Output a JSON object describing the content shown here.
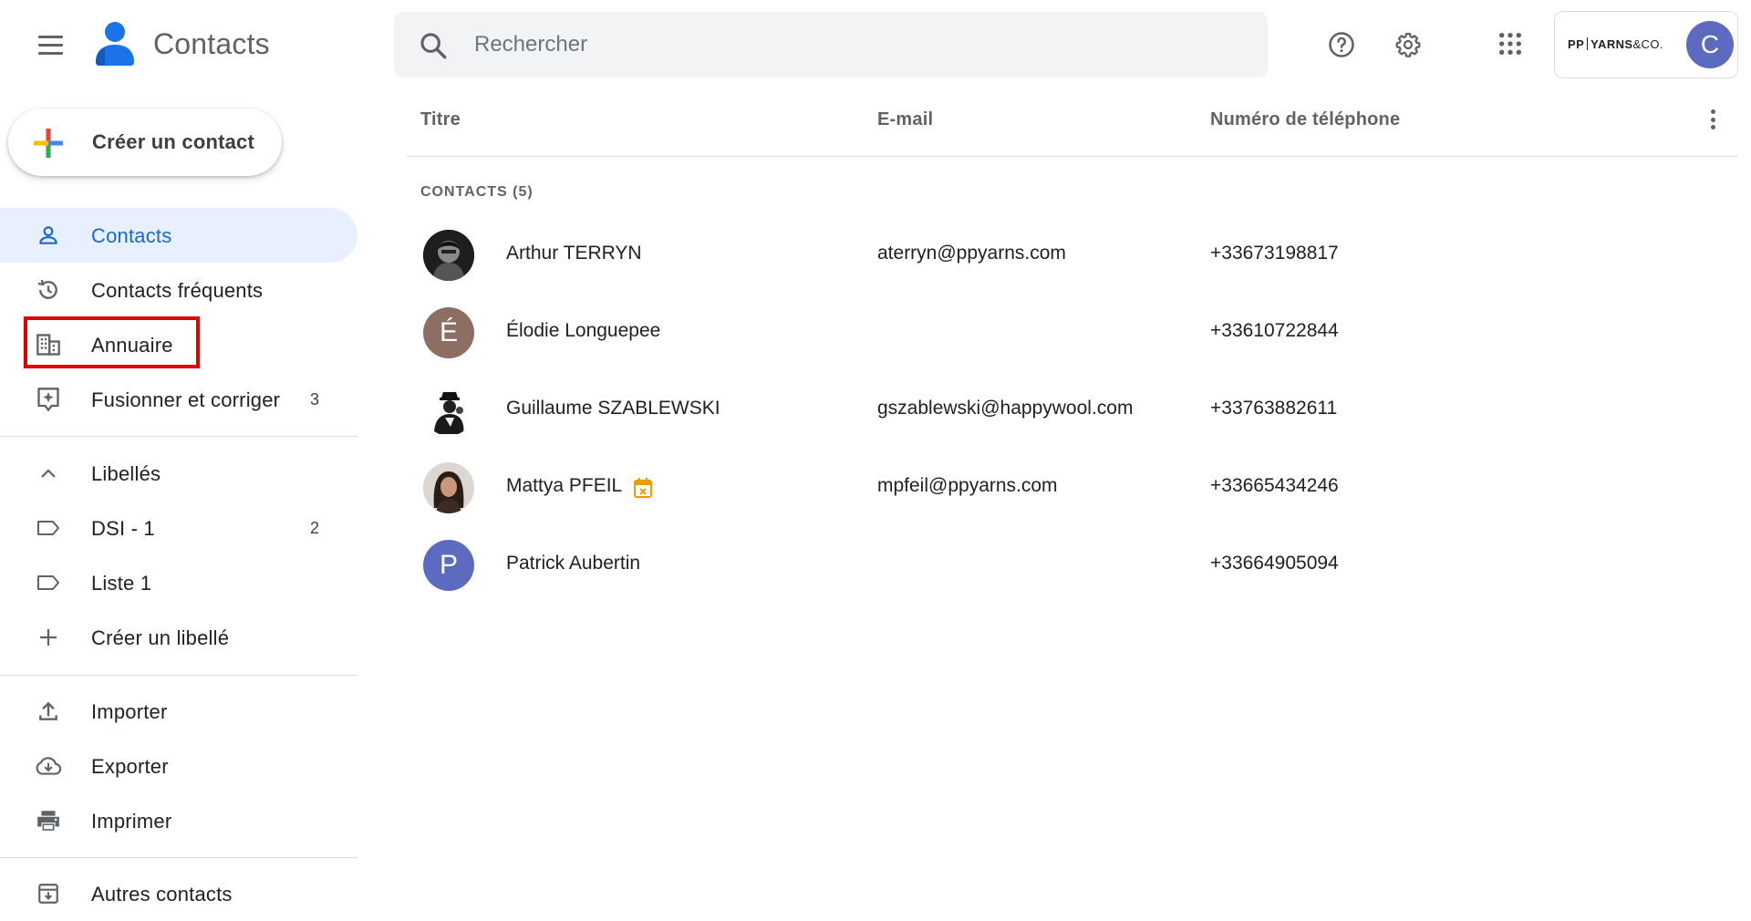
{
  "app": {
    "title": "Contacts"
  },
  "search": {
    "placeholder": "Rechercher",
    "value": ""
  },
  "account": {
    "org_logo_bold": "PP",
    "org_logo_mid": "YARNS",
    "org_logo_thin": "&CO.",
    "avatar_initial": "C",
    "avatar_color": "#5c6bc0"
  },
  "sidebar": {
    "create_label": "Créer un contact",
    "items": [
      {
        "label": "Contacts",
        "icon": "person-icon",
        "active": true
      },
      {
        "label": "Contacts fréquents",
        "icon": "history-icon"
      },
      {
        "label": "Annuaire",
        "icon": "directory-icon"
      },
      {
        "label": "Fusionner et corriger",
        "icon": "merge-icon",
        "count": "3"
      },
      {
        "label": "Libellés",
        "icon": "chevron-up-icon"
      },
      {
        "label": "DSI - 1",
        "icon": "label-icon",
        "count": "2"
      },
      {
        "label": "Liste 1",
        "icon": "label-icon"
      },
      {
        "label": "Créer un libellé",
        "icon": "plus-icon"
      },
      {
        "label": "Importer",
        "icon": "upload-icon"
      },
      {
        "label": "Exporter",
        "icon": "cloud-download-icon"
      },
      {
        "label": "Imprimer",
        "icon": "print-icon"
      },
      {
        "label": "Autres contacts",
        "icon": "archive-icon"
      }
    ]
  },
  "table": {
    "columns": [
      "Titre",
      "E-mail",
      "Numéro de téléphone"
    ],
    "section_title": "CONTACTS (5)",
    "rows": [
      {
        "name": "Arthur TERRYN",
        "email": "aterryn@ppyarns.com",
        "phone": "+33673198817",
        "avatar": "photo"
      },
      {
        "name": "Élodie Longuepee",
        "email": "",
        "phone": "+33610722844",
        "avatar_initial": "É",
        "avatar_color": "#8d6e63"
      },
      {
        "name": "Guillaume SZABLEWSKI",
        "email": "gszablewski@happywool.com",
        "phone": "+33763882611",
        "avatar": "photo"
      },
      {
        "name": "Mattya PFEIL",
        "email": "mpfeil@ppyarns.com",
        "phone": "+33665434246",
        "avatar": "photo",
        "badge_icon": "birthday-calendar-icon"
      },
      {
        "name": "Patrick Aubertin",
        "email": "",
        "phone": "+33664905094",
        "avatar_initial": "P",
        "avatar_color": "#5c6bc0"
      }
    ]
  },
  "colors": {
    "accent": "#1967d2",
    "active_bg": "#e8f0fe",
    "highlight_box": "#e00000"
  }
}
